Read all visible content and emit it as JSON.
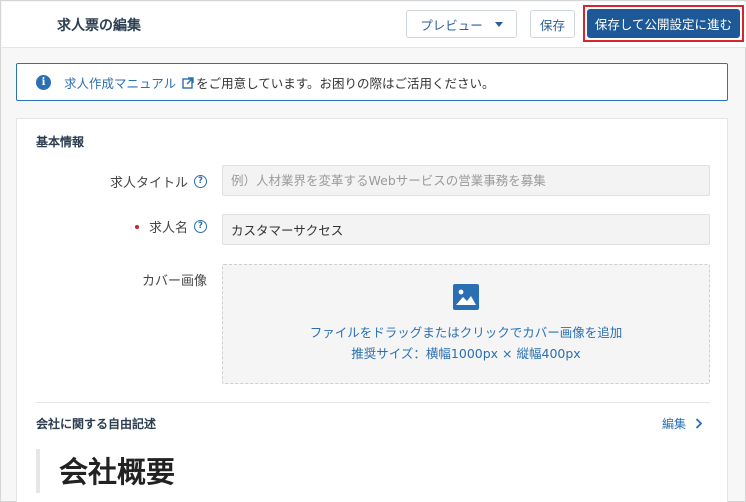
{
  "header": {
    "title": "求人票の編集",
    "preview_label": "プレビュー",
    "save_label": "保存",
    "publish_label": "保存して公開設定に進む"
  },
  "notice": {
    "icon": "info-icon",
    "link_text": "求人作成マニュアル",
    "link_icon": "external-link-icon",
    "text": "をご用意しています。お困りの際はご活用ください。"
  },
  "basic_info": {
    "section_title": "基本情報",
    "job_title": {
      "label": "求人タイトル",
      "value": "",
      "placeholder": "例）人材業界を変革するWebサービスの営業事務を募集"
    },
    "job_name": {
      "label": "求人名",
      "required": true,
      "value": "カスタマーサクセス"
    },
    "cover_image": {
      "label": "カバー画像",
      "icon": "image-icon",
      "drop_text": "ファイルをドラッグまたはクリックでカバー画像を追加",
      "size_text": "推奨サイズ：横幅1000px × 縦幅400px"
    }
  },
  "free_text": {
    "section_title": "会社に関する自由記述",
    "edit_label": "編集",
    "heading": "会社概要"
  },
  "colors": {
    "primary": "#1d5996",
    "link": "#2a6fb3",
    "required": "#c8242d",
    "highlight_border": "#d9232d"
  }
}
